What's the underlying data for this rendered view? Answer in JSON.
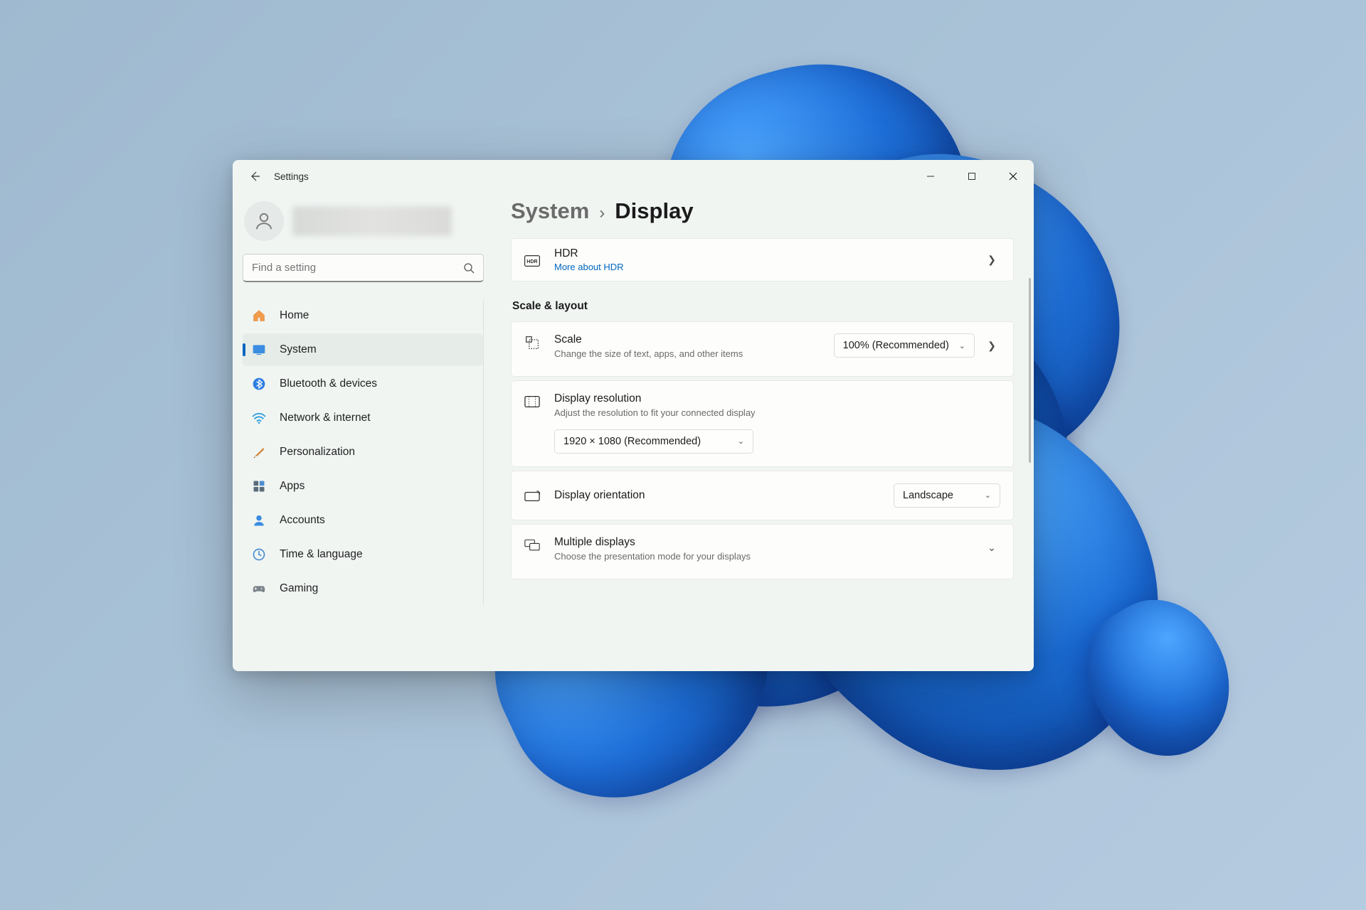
{
  "app_title": "Settings",
  "search": {
    "placeholder": "Find a setting"
  },
  "sidebar": {
    "items": [
      {
        "label": "Home"
      },
      {
        "label": "System"
      },
      {
        "label": "Bluetooth & devices"
      },
      {
        "label": "Network & internet"
      },
      {
        "label": "Personalization"
      },
      {
        "label": "Apps"
      },
      {
        "label": "Accounts"
      },
      {
        "label": "Time & language"
      },
      {
        "label": "Gaming"
      }
    ]
  },
  "breadcrumb": {
    "parent": "System",
    "current": "Display"
  },
  "hdr": {
    "title": "HDR",
    "link": "More about HDR"
  },
  "section_scale_layout": "Scale & layout",
  "scale": {
    "title": "Scale",
    "sub": "Change the size of text, apps, and other items",
    "value": "100% (Recommended)"
  },
  "resolution": {
    "title": "Display resolution",
    "sub": "Adjust the resolution to fit your connected display",
    "value": "1920 × 1080 (Recommended)"
  },
  "orientation": {
    "title": "Display orientation",
    "value": "Landscape"
  },
  "multi": {
    "title": "Multiple displays",
    "sub": "Choose the presentation mode for your displays"
  }
}
